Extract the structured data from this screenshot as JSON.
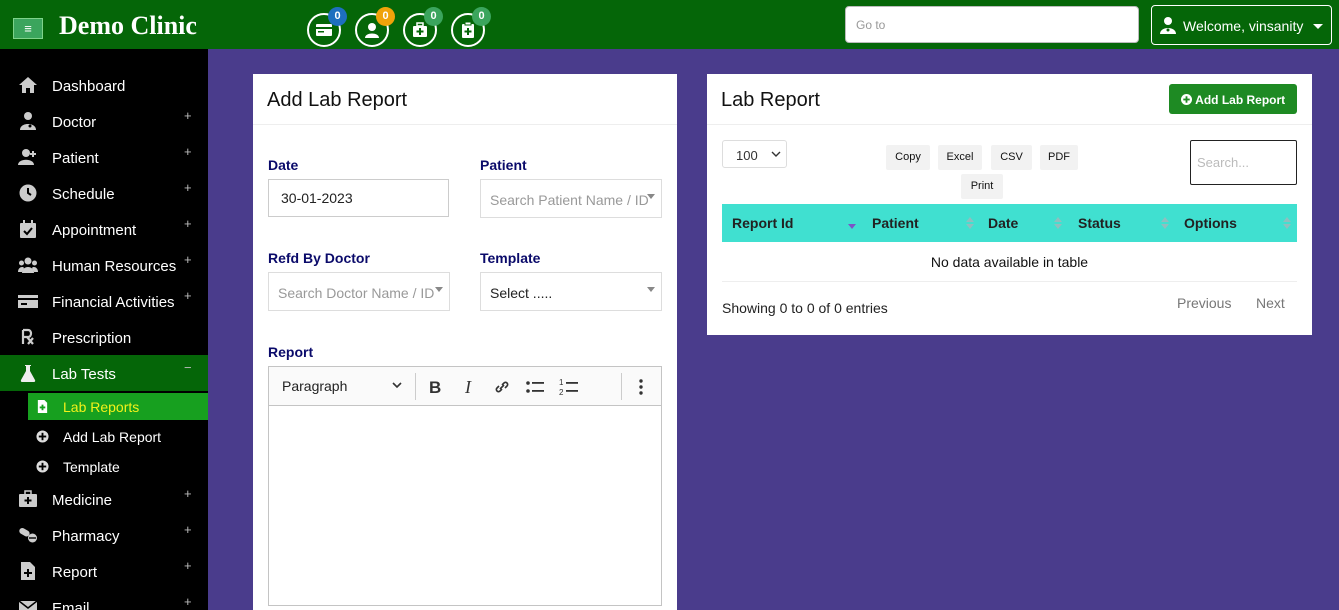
{
  "header": {
    "menu_icon": "≡",
    "brand": "Demo Clinic",
    "icons": [
      {
        "name": "billing-icon",
        "count": "0",
        "badge_color": "#1e6fbf"
      },
      {
        "name": "user-icon",
        "count": "0",
        "badge_color": "#f0a30a"
      },
      {
        "name": "medical-kit-icon",
        "count": "0",
        "badge_color": "#3ba55d"
      },
      {
        "name": "clipboard-medical-icon",
        "count": "0",
        "badge_color": "#3ba55d"
      }
    ],
    "goto_placeholder": "Go to",
    "welcome": "Welcome, vinsanity"
  },
  "sidebar": {
    "items": [
      {
        "label": "Dashboard",
        "icon": "home-icon",
        "expand": ""
      },
      {
        "label": "Doctor",
        "icon": "doctor-icon",
        "expand": "+"
      },
      {
        "label": "Patient",
        "icon": "patient-icon",
        "expand": "+"
      },
      {
        "label": "Schedule",
        "icon": "clock-icon",
        "expand": "+"
      },
      {
        "label": "Appointment",
        "icon": "calendar-check-icon",
        "expand": "+"
      },
      {
        "label": "Human Resources",
        "icon": "users-icon",
        "expand": "+"
      },
      {
        "label": "Financial Activities",
        "icon": "money-icon",
        "expand": "+"
      },
      {
        "label": "Prescription",
        "icon": "prescription-icon",
        "expand": ""
      },
      {
        "label": "Lab Tests",
        "icon": "flask-icon",
        "expand": "−"
      },
      {
        "label": "Medicine",
        "icon": "medkit-icon",
        "expand": "+"
      },
      {
        "label": "Pharmacy",
        "icon": "pills-icon",
        "expand": "+"
      },
      {
        "label": "Report",
        "icon": "file-medical-icon",
        "expand": "+"
      },
      {
        "label": "Email",
        "icon": "mail-icon",
        "expand": "+"
      }
    ],
    "sub_items": [
      {
        "label": "Lab Reports",
        "icon": "file-plus-icon"
      },
      {
        "label": "Add Lab Report",
        "icon": "plus-circle-icon"
      },
      {
        "label": "Template",
        "icon": "plus-circle-icon"
      }
    ]
  },
  "form": {
    "title": "Add Lab Report",
    "date_label": "Date",
    "date_value": "30-01-2023",
    "patient_label": "Patient",
    "patient_placeholder": "Search Patient Name / ID",
    "doctor_label": "Refd By Doctor",
    "doctor_placeholder": "Search Doctor Name / ID",
    "template_label": "Template",
    "template_placeholder": "Select .....",
    "report_label": "Report",
    "editor_paragraph": "Paragraph"
  },
  "table": {
    "title": "Lab Report",
    "add_button": "Add Lab Report",
    "length": "100",
    "buttons": [
      "Copy",
      "Excel",
      "CSV",
      "PDF",
      "Print"
    ],
    "search_placeholder": "Search...",
    "columns": [
      "Report Id",
      "Patient",
      "Date",
      "Status",
      "Options"
    ],
    "empty_text": "No data available in table",
    "info": "Showing 0 to 0 of 0 entries",
    "prev": "Previous",
    "next": "Next",
    "header_color": "#40e0d0"
  }
}
